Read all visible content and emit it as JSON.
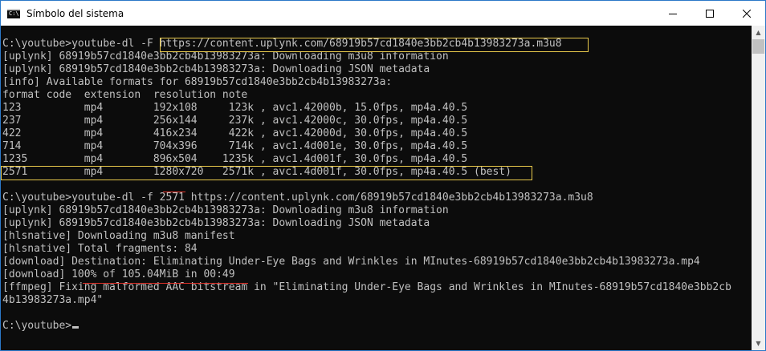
{
  "window": {
    "title": "Símbolo del sistema",
    "icon_text": "C:\\",
    "icons": {
      "minimize": "minimize-icon",
      "maximize": "maximize-icon",
      "close": "close-icon"
    }
  },
  "colors": {
    "text": "#c0c0c0",
    "background": "#0c0c0c",
    "highlight": "#e8c94b",
    "underline": "#e0322a"
  },
  "terminal": {
    "lines": [
      "C:\\youtube>youtube-dl -F https://content.uplynk.com/68919b57cd1840e3bb2cb4b13983273a.m3u8",
      "[uplynk] 68919b57cd1840e3bb2cb4b13983273a: Downloading m3u8 information",
      "[uplynk] 68919b57cd1840e3bb2cb4b13983273a: Downloading JSON metadata",
      "[info] Available formats for 68919b57cd1840e3bb2cb4b13983273a:",
      "format code  extension  resolution note",
      "123          mp4        192x108     123k , avc1.42000b, 15.0fps, mp4a.40.5",
      "237          mp4        256x144     237k , avc1.42000c, 30.0fps, mp4a.40.5",
      "422          mp4        416x234     422k , avc1.42000d, 30.0fps, mp4a.40.5",
      "714          mp4        704x396     714k , avc1.4d001e, 30.0fps, mp4a.40.5",
      "1235         mp4        896x504    1235k , avc1.4d001f, 30.0fps, mp4a.40.5",
      "2571         mp4        1280x720   2571k , avc1.4d001f, 30.0fps, mp4a.40.5 (best)",
      "",
      "C:\\youtube>youtube-dl -f 2571 https://content.uplynk.com/68919b57cd1840e3bb2cb4b13983273a.m3u8",
      "[uplynk] 68919b57cd1840e3bb2cb4b13983273a: Downloading m3u8 information",
      "[uplynk] 68919b57cd1840e3bb2cb4b13983273a: Downloading JSON metadata",
      "[hlsnative] Downloading m3u8 manifest",
      "[hlsnative] Total fragments: 84",
      "[download] Destination: Eliminating Under-Eye Bags and Wrinkles in MInutes-68919b57cd1840e3bb2cb4b13983273a.mp4",
      "[download] 100% of 105.04MiB in 00:49",
      "[ffmpeg] Fixing malformed AAC bitstream in \"Eliminating Under-Eye Bags and Wrinkles in MInutes-68919b57cd1840e3bb2cb",
      "4b13983273a.mp4\"",
      "",
      "C:\\youtube>"
    ]
  }
}
